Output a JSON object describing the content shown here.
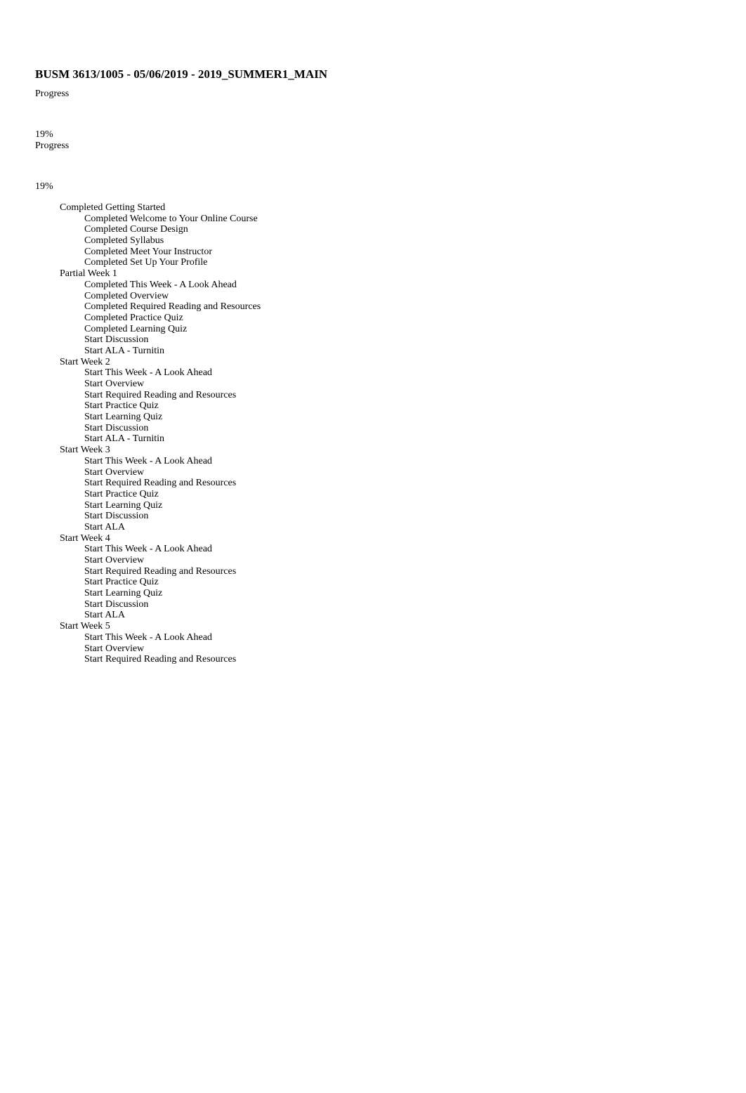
{
  "course": {
    "title": "BUSM 3613/1005 - 05/06/2019 - 2019_SUMMER1_MAIN"
  },
  "progress_blocks": [
    {
      "label": "Progress",
      "value": "19%",
      "percent": 19
    },
    {
      "label": "Progress",
      "value": "19%",
      "percent": 19
    }
  ],
  "outline": [
    {
      "status": "Completed",
      "name": "Getting Started",
      "items": [
        {
          "status": "Completed",
          "name": "Welcome to Your Online Course"
        },
        {
          "status": "Completed",
          "name": "Course Design"
        },
        {
          "status": "Completed",
          "name": "Syllabus"
        },
        {
          "status": "Completed",
          "name": "Meet Your Instructor"
        },
        {
          "status": "Completed",
          "name": "Set Up Your Profile"
        }
      ]
    },
    {
      "status": "Partial",
      "name": "Week 1",
      "items": [
        {
          "status": "Completed",
          "name": "This Week - A Look Ahead"
        },
        {
          "status": "Completed",
          "name": "Overview"
        },
        {
          "status": "Completed",
          "name": "Required Reading and Resources"
        },
        {
          "status": "Completed",
          "name": "Practice Quiz"
        },
        {
          "status": "Completed",
          "name": "Learning Quiz"
        },
        {
          "status": "Start",
          "name": "Discussion"
        },
        {
          "status": "Start",
          "name": "ALA - Turnitin"
        }
      ]
    },
    {
      "status": "Start",
      "name": "Week 2",
      "items": [
        {
          "status": "Start",
          "name": "This Week - A Look Ahead"
        },
        {
          "status": "Start",
          "name": "Overview"
        },
        {
          "status": "Start",
          "name": "Required Reading and Resources"
        },
        {
          "status": "Start",
          "name": "Practice Quiz"
        },
        {
          "status": "Start",
          "name": "Learning Quiz"
        },
        {
          "status": "Start",
          "name": "Discussion"
        },
        {
          "status": "Start",
          "name": "ALA - Turnitin"
        }
      ]
    },
    {
      "status": "Start",
      "name": "Week 3",
      "items": [
        {
          "status": "Start",
          "name": "This Week - A Look Ahead"
        },
        {
          "status": "Start",
          "name": "Overview"
        },
        {
          "status": "Start",
          "name": "Required Reading and Resources"
        },
        {
          "status": "Start",
          "name": "Practice Quiz"
        },
        {
          "status": "Start",
          "name": "Learning Quiz"
        },
        {
          "status": "Start",
          "name": "Discussion"
        },
        {
          "status": "Start",
          "name": "ALA"
        }
      ]
    },
    {
      "status": "Start",
      "name": "Week 4",
      "items": [
        {
          "status": "Start",
          "name": "This Week - A Look Ahead"
        },
        {
          "status": "Start",
          "name": "Overview"
        },
        {
          "status": "Start",
          "name": "Required Reading and Resources"
        },
        {
          "status": "Start",
          "name": "Practice Quiz"
        },
        {
          "status": "Start",
          "name": "Learning Quiz"
        },
        {
          "status": "Start",
          "name": "Discussion"
        },
        {
          "status": "Start",
          "name": "ALA"
        }
      ]
    },
    {
      "status": "Start",
      "name": "Week 5",
      "items": [
        {
          "status": "Start",
          "name": "This Week - A Look Ahead"
        },
        {
          "status": "Start",
          "name": "Overview"
        },
        {
          "status": "Start",
          "name": "Required Reading and Resources"
        }
      ]
    }
  ]
}
